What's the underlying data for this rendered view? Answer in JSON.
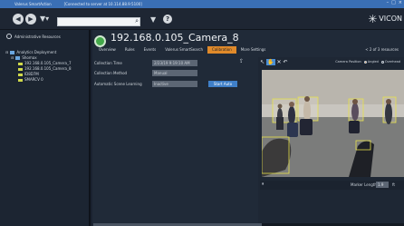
{
  "titlebar": {
    "app_name": "Valerus SmartAction",
    "connection": "[Connected to server at 10.114.88.9:5100]",
    "win_buttons": [
      "–",
      "□",
      "×"
    ]
  },
  "toolbar": {
    "back_icon": "back-arrow-icon",
    "forward_icon": "forward-arrow-icon",
    "menu_icon": "funnel-menu-icon",
    "search_placeholder": "",
    "search_icon": "magnifier-icon",
    "filter_icon": "filter-icon",
    "help_label": "?",
    "logo_text": "VICON"
  },
  "sidebar": {
    "header": "Administrative Resources",
    "tree": [
      {
        "label": "Analytics Deployment",
        "level": 0,
        "type": "root"
      },
      {
        "label": "Shomax",
        "level": 1,
        "type": "group"
      },
      {
        "label": "192.168.0.105_Camera_7",
        "level": 2,
        "type": "camera"
      },
      {
        "label": "192.168.0.105_Camera_8",
        "level": 2,
        "type": "camera",
        "selected": true
      },
      {
        "label": "ID8D7M",
        "level": 2,
        "type": "camera"
      },
      {
        "label": "SMARCV 0",
        "level": 2,
        "type": "camera"
      }
    ]
  },
  "camera": {
    "title": "192.168.0.105_Camera_8",
    "status_color": "#43a84a",
    "tabs": [
      {
        "label": "Overview",
        "active": false
      },
      {
        "label": "Rules",
        "active": false
      },
      {
        "label": "Events",
        "active": false
      },
      {
        "label": "Valerus SmartSearch",
        "active": false
      },
      {
        "label": "Calibration",
        "active": true
      },
      {
        "label": "More Settings",
        "active": false
      }
    ],
    "nav_label": "< 2 of 3 resources"
  },
  "form": {
    "collection_time_label": "Collection Time",
    "collection_time_value": "2/23/19 9:19:10 AM",
    "collection_method_label": "Collection Method",
    "collection_method_value": "Manual",
    "auto_scene_label": "Automatic Scene Learning",
    "auto_scene_value": "Inactive",
    "start_button": "Start Auto"
  },
  "viewer": {
    "tools": [
      "pointer-icon",
      "hand-icon",
      "close-icon",
      "undo-icon"
    ],
    "camera_position_label": "Camera Position",
    "angled_label": "Angled",
    "overhead_label": "Overhead",
    "angled_selected": true,
    "marker_length_label": "Marker Length",
    "marker_length_value": "1.9",
    "marker_unit": "ft"
  },
  "accent_color": "#e08a2a",
  "highlight_color": "#3f7fc8"
}
